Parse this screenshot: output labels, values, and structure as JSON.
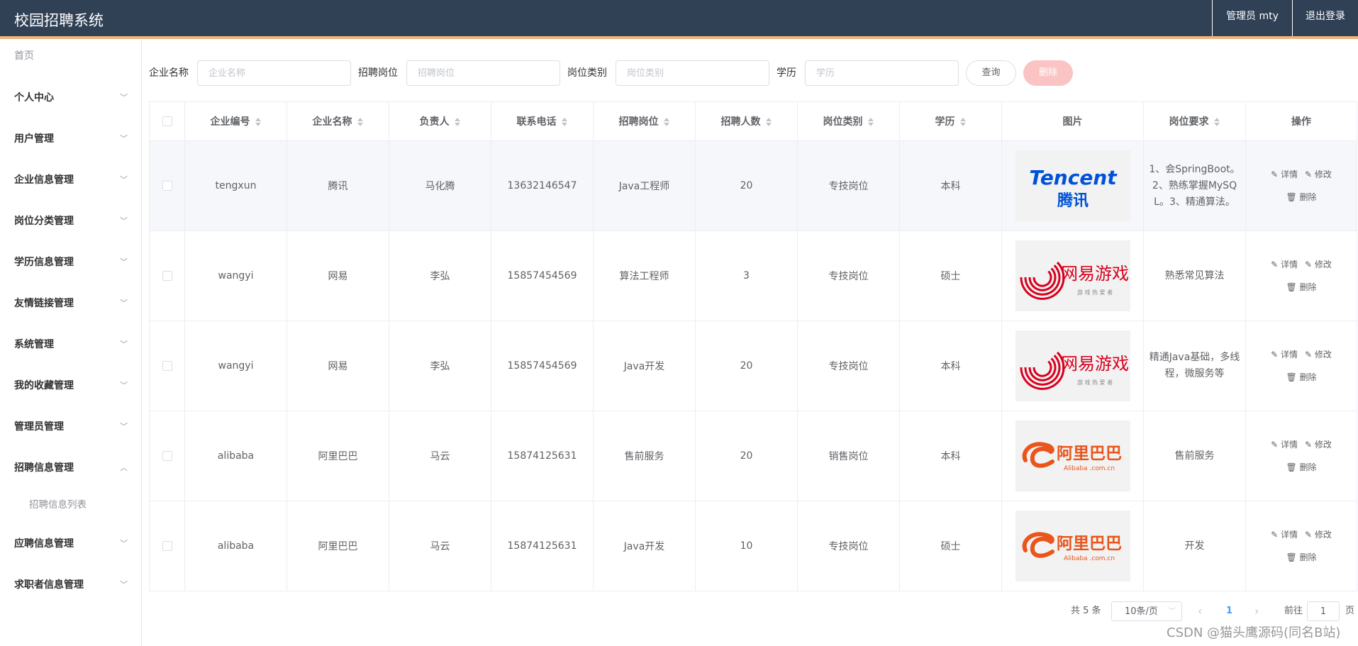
{
  "header": {
    "title": "校园招聘系统",
    "admin": "管理员 mty",
    "logout": "退出登录"
  },
  "sidebar": {
    "home": "首页",
    "items": [
      {
        "label": "个人中心",
        "expanded": false
      },
      {
        "label": "用户管理",
        "expanded": false
      },
      {
        "label": "企业信息管理",
        "expanded": false
      },
      {
        "label": "岗位分类管理",
        "expanded": false
      },
      {
        "label": "学历信息管理",
        "expanded": false
      },
      {
        "label": "友情链接管理",
        "expanded": false
      },
      {
        "label": "系统管理",
        "expanded": false
      },
      {
        "label": "我的收藏管理",
        "expanded": false
      },
      {
        "label": "管理员管理",
        "expanded": false
      },
      {
        "label": "招聘信息管理",
        "expanded": true
      },
      {
        "label": "应聘信息管理",
        "expanded": false
      },
      {
        "label": "求职者信息管理",
        "expanded": false
      }
    ],
    "sub_item": "招聘信息列表"
  },
  "search": {
    "company_label": "企业名称",
    "company_placeholder": "企业名称",
    "position_label": "招聘岗位",
    "position_placeholder": "招聘岗位",
    "category_label": "岗位类别",
    "category_placeholder": "岗位类别",
    "edu_label": "学历",
    "edu_placeholder": "学历",
    "query": "查询",
    "delete": "删除"
  },
  "table": {
    "headers": [
      "企业编号",
      "企业名称",
      "负责人",
      "联系电话",
      "招聘岗位",
      "招聘人数",
      "岗位类别",
      "学历",
      "图片",
      "岗位要求",
      "操作"
    ],
    "rows": [
      {
        "id": "tengxun",
        "company": "腾讯",
        "person": "马化腾",
        "phone": "13632146547",
        "position": "Java工程师",
        "count": "20",
        "category": "专技岗位",
        "edu": "本科",
        "logo": "tencent",
        "req": "1、会SpringBoot。2、熟练掌握MySQL。3、精通算法。"
      },
      {
        "id": "wangyi",
        "company": "网易",
        "person": "李弘",
        "phone": "15857454569",
        "position": "算法工程师",
        "count": "3",
        "category": "专技岗位",
        "edu": "硕士",
        "logo": "netease",
        "req": "熟悉常见算法"
      },
      {
        "id": "wangyi",
        "company": "网易",
        "person": "李弘",
        "phone": "15857454569",
        "position": "Java开发",
        "count": "20",
        "category": "专技岗位",
        "edu": "本科",
        "logo": "netease",
        "req": "精通Java基础，多线程，微服务等"
      },
      {
        "id": "alibaba",
        "company": "阿里巴巴",
        "person": "马云",
        "phone": "15874125631",
        "position": "售前服务",
        "count": "20",
        "category": "销售岗位",
        "edu": "本科",
        "logo": "alibaba",
        "req": "售前服务"
      },
      {
        "id": "alibaba",
        "company": "阿里巴巴",
        "person": "马云",
        "phone": "15874125631",
        "position": "Java开发",
        "count": "10",
        "category": "专技岗位",
        "edu": "硕士",
        "logo": "alibaba",
        "req": "开发"
      }
    ],
    "ops": {
      "detail": "详情",
      "edit": "修改",
      "delete": "删除"
    }
  },
  "logos": {
    "tencent": {
      "line1": "Tencent",
      "line2": "腾讯"
    },
    "netease": {
      "line1": "网易游戏",
      "line2": "游 戏 热 爱 者"
    },
    "alibaba": {
      "line1": "阿里巴巴",
      "line2": "Alibaba .com.cn"
    }
  },
  "pagination": {
    "total": "共 5 条",
    "page_size": "10条/页",
    "current": "1",
    "goto_label": "前往",
    "goto_value": "1",
    "page_suffix": "页"
  },
  "watermark": "CSDN @猫头鹰源码(同名B站)",
  "colors": {
    "header_bg": "#304156",
    "header_accent": "#f2b27c",
    "link": "#409eff",
    "delete_disabled": "#fbc4c4",
    "tencent_blue": "#0052d9",
    "netease_red": "#d7001e",
    "alibaba_orange": "#e9551b"
  }
}
